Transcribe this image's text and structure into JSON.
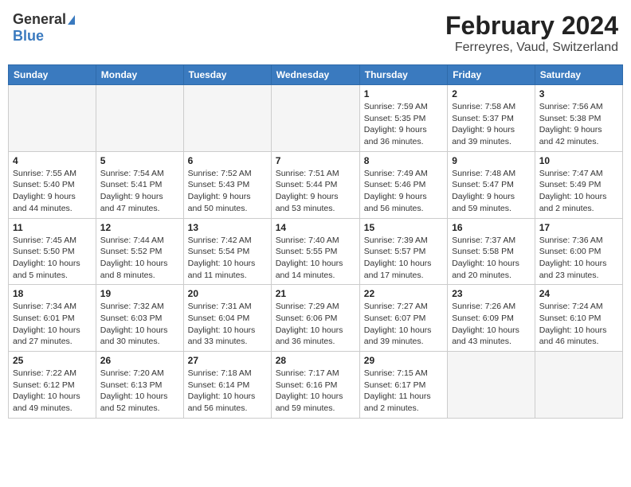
{
  "header": {
    "logo_general": "General",
    "logo_blue": "Blue",
    "title": "February 2024",
    "subtitle": "Ferreyres, Vaud, Switzerland"
  },
  "weekdays": [
    "Sunday",
    "Monday",
    "Tuesday",
    "Wednesday",
    "Thursday",
    "Friday",
    "Saturday"
  ],
  "weeks": [
    [
      {
        "day": "",
        "info": ""
      },
      {
        "day": "",
        "info": ""
      },
      {
        "day": "",
        "info": ""
      },
      {
        "day": "",
        "info": ""
      },
      {
        "day": "1",
        "info": "Sunrise: 7:59 AM\nSunset: 5:35 PM\nDaylight: 9 hours\nand 36 minutes."
      },
      {
        "day": "2",
        "info": "Sunrise: 7:58 AM\nSunset: 5:37 PM\nDaylight: 9 hours\nand 39 minutes."
      },
      {
        "day": "3",
        "info": "Sunrise: 7:56 AM\nSunset: 5:38 PM\nDaylight: 9 hours\nand 42 minutes."
      }
    ],
    [
      {
        "day": "4",
        "info": "Sunrise: 7:55 AM\nSunset: 5:40 PM\nDaylight: 9 hours\nand 44 minutes."
      },
      {
        "day": "5",
        "info": "Sunrise: 7:54 AM\nSunset: 5:41 PM\nDaylight: 9 hours\nand 47 minutes."
      },
      {
        "day": "6",
        "info": "Sunrise: 7:52 AM\nSunset: 5:43 PM\nDaylight: 9 hours\nand 50 minutes."
      },
      {
        "day": "7",
        "info": "Sunrise: 7:51 AM\nSunset: 5:44 PM\nDaylight: 9 hours\nand 53 minutes."
      },
      {
        "day": "8",
        "info": "Sunrise: 7:49 AM\nSunset: 5:46 PM\nDaylight: 9 hours\nand 56 minutes."
      },
      {
        "day": "9",
        "info": "Sunrise: 7:48 AM\nSunset: 5:47 PM\nDaylight: 9 hours\nand 59 minutes."
      },
      {
        "day": "10",
        "info": "Sunrise: 7:47 AM\nSunset: 5:49 PM\nDaylight: 10 hours\nand 2 minutes."
      }
    ],
    [
      {
        "day": "11",
        "info": "Sunrise: 7:45 AM\nSunset: 5:50 PM\nDaylight: 10 hours\nand 5 minutes."
      },
      {
        "day": "12",
        "info": "Sunrise: 7:44 AM\nSunset: 5:52 PM\nDaylight: 10 hours\nand 8 minutes."
      },
      {
        "day": "13",
        "info": "Sunrise: 7:42 AM\nSunset: 5:54 PM\nDaylight: 10 hours\nand 11 minutes."
      },
      {
        "day": "14",
        "info": "Sunrise: 7:40 AM\nSunset: 5:55 PM\nDaylight: 10 hours\nand 14 minutes."
      },
      {
        "day": "15",
        "info": "Sunrise: 7:39 AM\nSunset: 5:57 PM\nDaylight: 10 hours\nand 17 minutes."
      },
      {
        "day": "16",
        "info": "Sunrise: 7:37 AM\nSunset: 5:58 PM\nDaylight: 10 hours\nand 20 minutes."
      },
      {
        "day": "17",
        "info": "Sunrise: 7:36 AM\nSunset: 6:00 PM\nDaylight: 10 hours\nand 23 minutes."
      }
    ],
    [
      {
        "day": "18",
        "info": "Sunrise: 7:34 AM\nSunset: 6:01 PM\nDaylight: 10 hours\nand 27 minutes."
      },
      {
        "day": "19",
        "info": "Sunrise: 7:32 AM\nSunset: 6:03 PM\nDaylight: 10 hours\nand 30 minutes."
      },
      {
        "day": "20",
        "info": "Sunrise: 7:31 AM\nSunset: 6:04 PM\nDaylight: 10 hours\nand 33 minutes."
      },
      {
        "day": "21",
        "info": "Sunrise: 7:29 AM\nSunset: 6:06 PM\nDaylight: 10 hours\nand 36 minutes."
      },
      {
        "day": "22",
        "info": "Sunrise: 7:27 AM\nSunset: 6:07 PM\nDaylight: 10 hours\nand 39 minutes."
      },
      {
        "day": "23",
        "info": "Sunrise: 7:26 AM\nSunset: 6:09 PM\nDaylight: 10 hours\nand 43 minutes."
      },
      {
        "day": "24",
        "info": "Sunrise: 7:24 AM\nSunset: 6:10 PM\nDaylight: 10 hours\nand 46 minutes."
      }
    ],
    [
      {
        "day": "25",
        "info": "Sunrise: 7:22 AM\nSunset: 6:12 PM\nDaylight: 10 hours\nand 49 minutes."
      },
      {
        "day": "26",
        "info": "Sunrise: 7:20 AM\nSunset: 6:13 PM\nDaylight: 10 hours\nand 52 minutes."
      },
      {
        "day": "27",
        "info": "Sunrise: 7:18 AM\nSunset: 6:14 PM\nDaylight: 10 hours\nand 56 minutes."
      },
      {
        "day": "28",
        "info": "Sunrise: 7:17 AM\nSunset: 6:16 PM\nDaylight: 10 hours\nand 59 minutes."
      },
      {
        "day": "29",
        "info": "Sunrise: 7:15 AM\nSunset: 6:17 PM\nDaylight: 11 hours\nand 2 minutes."
      },
      {
        "day": "",
        "info": ""
      },
      {
        "day": "",
        "info": ""
      }
    ]
  ]
}
